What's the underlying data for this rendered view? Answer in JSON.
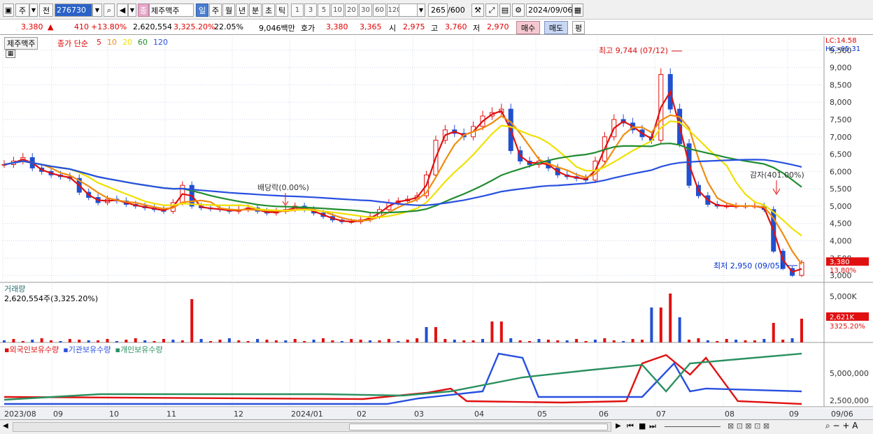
{
  "toolbar": {
    "type_label": "주",
    "prev_label": "전",
    "code": "276730",
    "company_badge": "종",
    "company_name": "제주맥주",
    "periods": [
      "일",
      "주",
      "월",
      "년",
      "분",
      "초",
      "틱"
    ],
    "active_period": "일",
    "minutes": [
      "1",
      "3",
      "5",
      "10",
      "20",
      "30",
      "60",
      "120"
    ],
    "count": "265",
    "count_total": "/600",
    "date": "2024/09/06"
  },
  "quote": {
    "price": "3,380",
    "arrow": "▲",
    "change": "410",
    "change_pct": "+13.80%",
    "volume": "2,620,554",
    "volume_pct": "3,325.20%",
    "turnover": "22.05%",
    "amount": "9,046백만",
    "bid_label": "호가",
    "ask": "3,380",
    "bid": "3,365",
    "open_label": "시",
    "open": "2,975",
    "high_label": "고",
    "high": "3,760",
    "low_label": "저",
    "low": "2,970",
    "buy_label": "매수",
    "sell_label": "매도",
    "eval_label": "평"
  },
  "price_panel": {
    "stock_tag": "제주맥주",
    "legend": {
      "prefix": "종가 단순",
      "ma": [
        "5",
        "10",
        "20",
        "60",
        "120"
      ]
    },
    "ma_colors": {
      "ma5": "#e01010",
      "ma10": "#f08c10",
      "ma20": "#f0e000",
      "ma60": "#208c30",
      "ma120": "#2850e0"
    },
    "lc": "LC:14.58",
    "hc": "HC:-65.31",
    "y_ticks": [
      "9,500",
      "9,000",
      "8,500",
      "8,000",
      "7,500",
      "7,000",
      "6,500",
      "6,000",
      "5,500",
      "5,000",
      "4,500",
      "4,000",
      "3,500",
      "3,000"
    ],
    "price_box": "3,380",
    "pct_box": "13.80%",
    "annotations": {
      "high": "최고 9,744 (07/12)",
      "low": "최저 2,950 (09/05)",
      "dividend": "배당락(0.00%)",
      "capital_reduction": "감자(401.00%)"
    }
  },
  "volume_panel": {
    "title": "거래량",
    "summary": "2,620,554주(3,325.20%)",
    "y_tick": "5,000K",
    "value_box": "2,621K",
    "pct_text": "3325.20%"
  },
  "holding_panel": {
    "legends": [
      "외국인보유수량",
      "기관보유수량",
      "개인보유수량"
    ],
    "colors": [
      "#e01010",
      "#2850e0",
      "#2a9060"
    ],
    "y_ticks": [
      "5,000,000",
      "2,500,000"
    ]
  },
  "x_axis": [
    "2023/08",
    "09",
    "10",
    "11",
    "12",
    "2024/01",
    "02",
    "03",
    "04",
    "05",
    "06",
    "07",
    "08",
    "09",
    "09/06"
  ],
  "chart_data": {
    "type": "candlestick",
    "price_ylim": [
      2800,
      9900
    ],
    "price_close": [
      6200,
      6300,
      6400,
      6100,
      6000,
      5900,
      5850,
      5800,
      5400,
      5250,
      5100,
      5200,
      5150,
      5050,
      5000,
      4950,
      4900,
      4850,
      5100,
      5600,
      5000,
      4950,
      4920,
      4900,
      4850,
      4900,
      4950,
      4850,
      4800,
      4850,
      4900,
      5000,
      4900,
      4800,
      4700,
      4600,
      4550,
      4550,
      4600,
      4700,
      4900,
      5100,
      5150,
      5200,
      5300,
      5900,
      6900,
      7200,
      7100,
      7000,
      7300,
      7600,
      7700,
      7800,
      6600,
      6300,
      6200,
      6300,
      6100,
      5900,
      5850,
      5800,
      5750,
      6300,
      7000,
      7500,
      7400,
      7200,
      7000,
      6900,
      8800,
      7800,
      6800,
      5600,
      5300,
      5050,
      5000,
      5000,
      5000,
      5000,
      5000,
      4900,
      3700,
      3200,
      3000,
      3380
    ]
  }
}
